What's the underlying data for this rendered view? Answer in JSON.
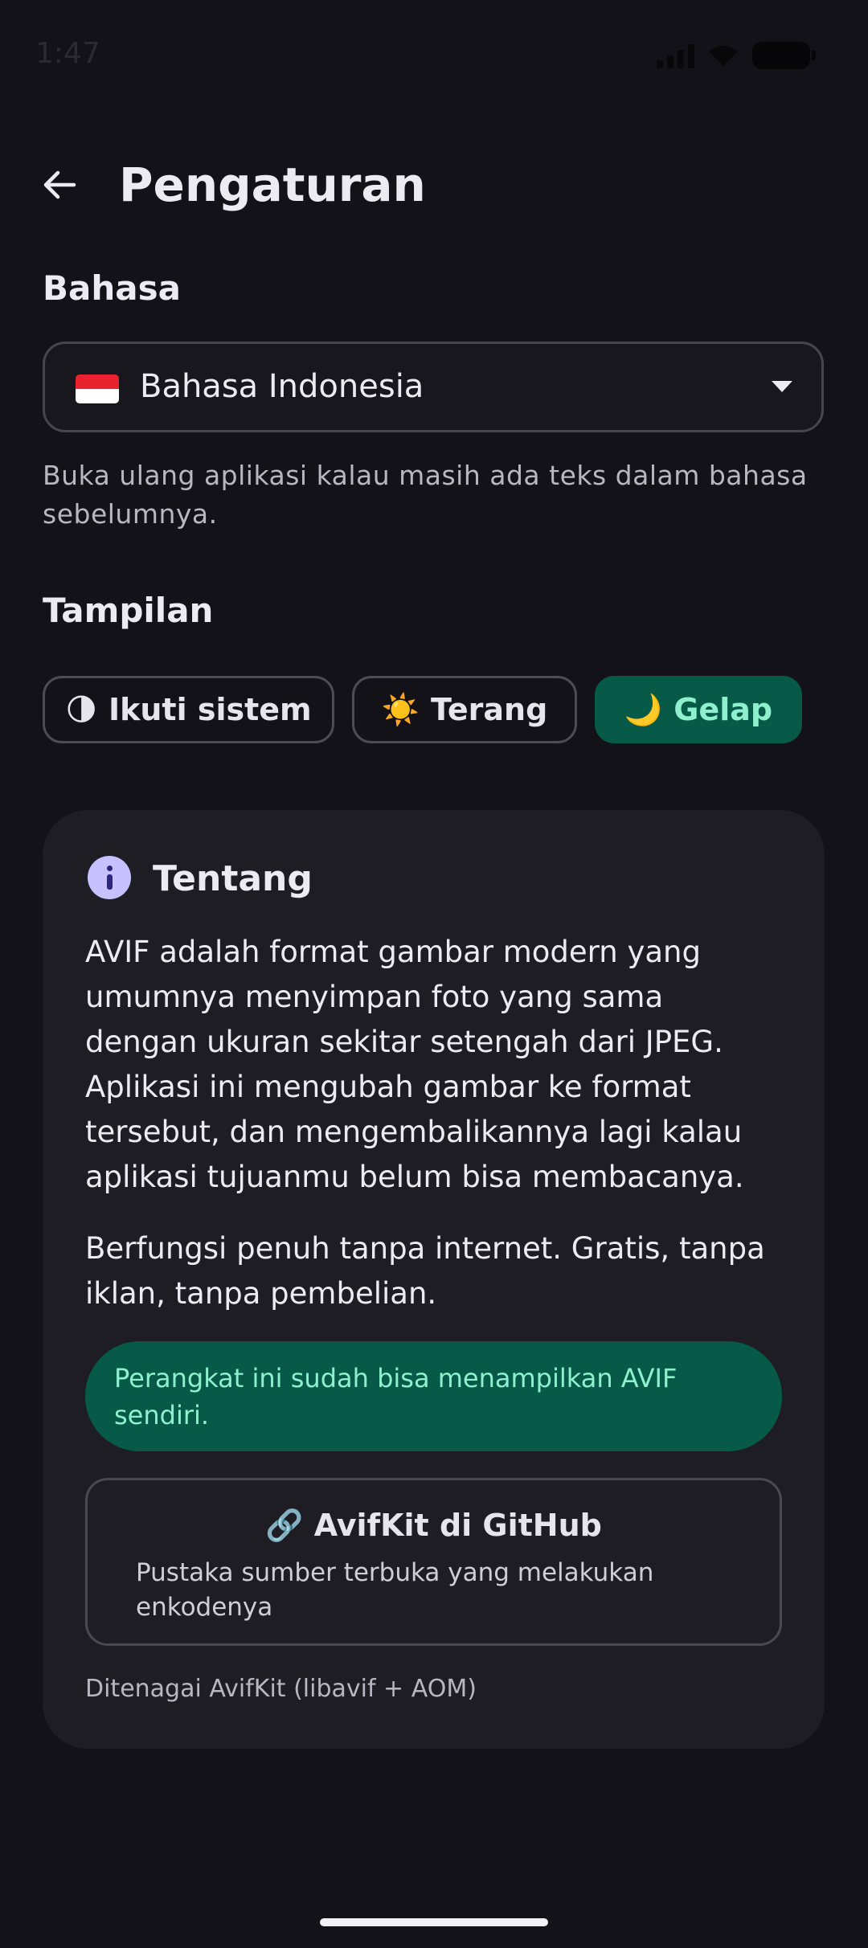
{
  "status_bar": {
    "time": "1:47"
  },
  "header": {
    "title": "Pengaturan",
    "back_icon": "arrow-left-icon"
  },
  "language": {
    "section_title": "Bahasa",
    "selected": "Bahasa Indonesia",
    "flag_icon": "indonesia-flag-icon",
    "helper_text": "Buka ulang aplikasi kalau masih ada teks dalam bahasa sebelumnya."
  },
  "appearance": {
    "section_title": "Tampilan",
    "options": [
      {
        "icon": "🌗",
        "label": "Ikuti sistem",
        "selected": false
      },
      {
        "icon": "☀️",
        "label": "Terang",
        "selected": false
      },
      {
        "icon": "🌙",
        "label": "Gelap",
        "selected": true
      }
    ]
  },
  "about": {
    "title": "Tentang",
    "paragraph1": "AVIF adalah format gambar modern yang umumnya menyimpan foto yang sama dengan ukuran sekitar setengah dari JPEG. Aplikasi ini mengubah gambar ke format tersebut, dan mengembalikannya lagi kalau aplikasi tujuanmu belum bisa membacanya.",
    "paragraph2": "Berfungsi penuh tanpa internet. Gratis, tanpa iklan, tanpa pembelian.",
    "support_banner": "Perangkat ini sudah bisa menampilkan AVIF sendiri.",
    "github_icon": "🔗",
    "github_label": "AvifKit di GitHub",
    "github_desc": "Pustaka sumber terbuka yang melakukan enkodenya",
    "powered_by": "Ditenagai AvifKit (libavif + AOM)"
  },
  "colors": {
    "background": "#131218",
    "card": "#1E1D24",
    "accent_bg": "#065A47",
    "accent_text": "#8FF0CE",
    "info_icon": "#C7C2FF"
  }
}
